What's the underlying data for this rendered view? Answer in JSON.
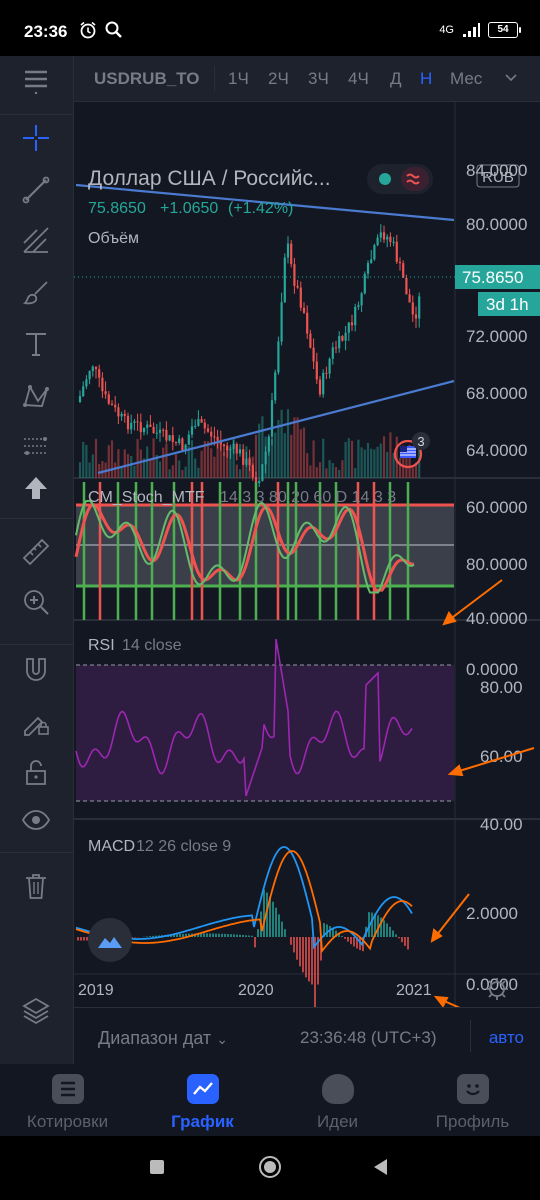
{
  "status_bar": {
    "time": "23:36",
    "network": "4G",
    "battery": "54"
  },
  "toolbar": {
    "symbol": "USDRUB_TO",
    "timeframes": [
      "1Ч",
      "2Ч",
      "3Ч",
      "4Ч",
      "Д",
      "Н",
      "Мес"
    ],
    "active_timeframe": "Н"
  },
  "left_tools": [
    "menu-icon",
    "crosshair-icon",
    "trendline-icon",
    "pitchfork-icon",
    "brush-icon",
    "text-icon",
    "pattern-icon",
    "measure-icon",
    "arrow-up-icon",
    "ruler-icon",
    "zoom-in-icon",
    "magnet-icon",
    "lock-drawing-icon",
    "unlock-icon",
    "eye-icon",
    "trash-icon",
    "layers-icon"
  ],
  "main_chart": {
    "title": "Доллар США / Российс...",
    "currency_badge": "RUB",
    "last_price": "75.8650",
    "change": "+1.0650",
    "change_pct": "(+1.42%)",
    "volume_label": "Объём",
    "price_tag": "75.8650",
    "countdown_tag": "3d 1h",
    "price_axis": [
      "84.0000",
      "80.0000",
      "72.0000",
      "68.0000",
      "64.0000",
      "60.0000"
    ],
    "events_badge": "3",
    "colors": {
      "up": "#26a69a",
      "down": "#ef5350",
      "trendline": "#4a7bd0",
      "accent": "#2962ff"
    }
  },
  "stoch_pane": {
    "title": "CM_Stoch_MTF",
    "params": "14 3 3 80 20 60 D 14 3 3",
    "axis": [
      "80.0000",
      "40.0000",
      "0.0000"
    ]
  },
  "rsi_pane": {
    "title": "RSI",
    "params": "14 close",
    "axis": [
      "80.00",
      "60.00",
      "40.00"
    ]
  },
  "macd_pane": {
    "title": "MACD",
    "params": "12 26 close 9",
    "axis": [
      "2.0000",
      "0.0000"
    ]
  },
  "time_axis": [
    "2019",
    "2020",
    "2021"
  ],
  "bottom_bar": {
    "date_range": "Диапазон дат",
    "clock": "23:36:48 (UTC+3)",
    "auto": "авто"
  },
  "bottom_nav": [
    {
      "label": "Котировки",
      "icon": "quotes-icon",
      "active": false
    },
    {
      "label": "График",
      "icon": "chart-icon",
      "active": true
    },
    {
      "label": "Идеи",
      "icon": "ideas-icon",
      "active": false
    },
    {
      "label": "Профиль",
      "icon": "profile-icon",
      "active": false
    }
  ]
}
